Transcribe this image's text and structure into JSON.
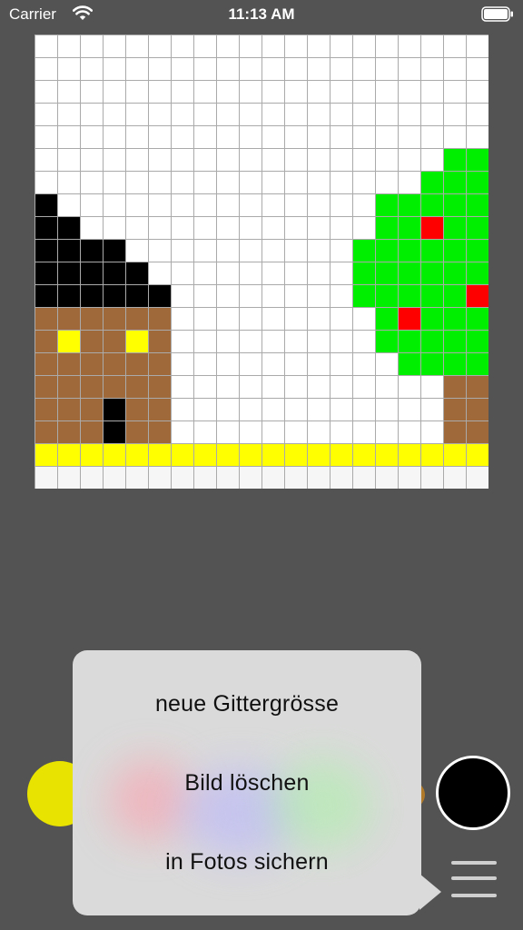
{
  "status_bar": {
    "carrier": "Carrier",
    "time": "11:13 AM"
  },
  "grid": {
    "columns": 20,
    "rows": 20,
    "colors": {
      "W": "#ffffff",
      "K": "#000000",
      "B": "#a0693a",
      "Y": "#ffff00",
      "G": "#00ee00",
      "R": "#ff0000",
      "F": "#f6f6f6"
    },
    "pixel_rows": [
      "WWWWWWWWWWWWWWWWWWWW",
      "WWWWWWWWWWWWWWWWWWWW",
      "WWWWWWWWWWWWWWWWWWWW",
      "WWWWWWWWWWWWWWWWWWWW",
      "WWWWWWWWWWWWWWWWWWWW",
      "WWWWWWWWWWWWWWWWWWGG",
      "WWWWWWWWWWWWWWWWWGGG",
      "KWWWWWWWWWWWWWWGGGGG",
      "KKWWWWWWWWWWWWWGGRGG",
      "KKKKWWWWWWWWWWGGGGGG",
      "KKKKKWWWWWWWWWGGGGGG",
      "KKKKKKWWWWWWWWGGGGGR",
      "BBBBBBWWWWWWWWWGRGGG",
      "BYBBYBWWWWWWWWWGGGGG",
      "BBBBBBWWWWWWWWWWGGGG",
      "BBBBBBWWWWWWWWWWWWBB",
      "BBBKBBWWWWWWWWWWWWBB",
      "BBBKBBWWWWWWWWWWWWBB",
      "YYYYYYYYYYYYYYYYYYYY",
      "FFFFFFFFFFFFFFFFFFFF"
    ]
  },
  "popover": {
    "items": [
      {
        "label": "neue Gittergrösse"
      },
      {
        "label": "Bild löschen"
      },
      {
        "label": "in Fotos sichern"
      }
    ]
  },
  "palette": {
    "selected_color": "#e8e300",
    "black_color": "#000000"
  }
}
